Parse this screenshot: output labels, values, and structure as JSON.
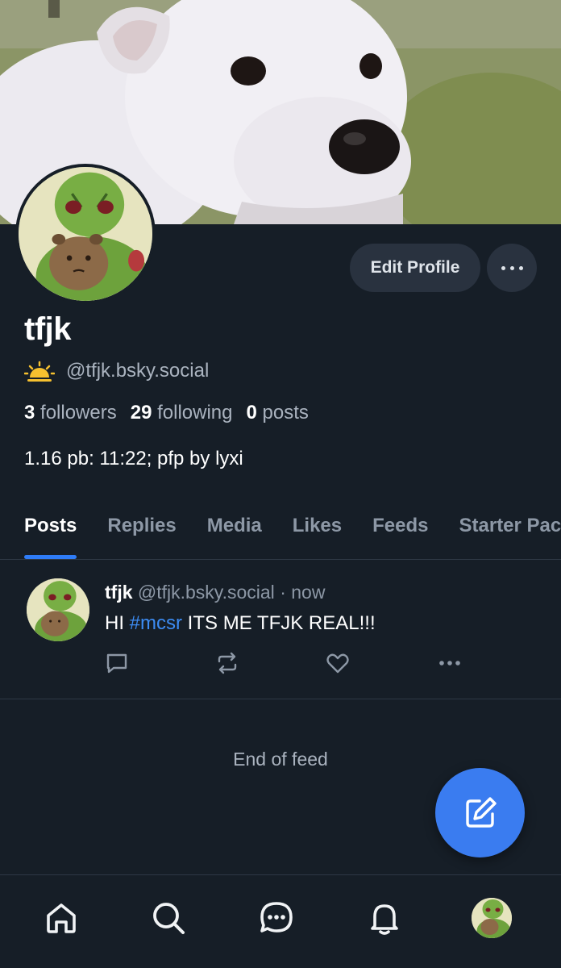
{
  "profile": {
    "display_name": "tfjk",
    "handle": "@tfjk.bsky.social",
    "bio": "1.16 pb: 11:22; pfp by lyxi",
    "status_icon": "sunrise-icon",
    "stats": {
      "followers_count": "3",
      "followers_label": "followers",
      "following_count": "29",
      "following_label": "following",
      "posts_count": "0",
      "posts_label": "posts"
    }
  },
  "header": {
    "edit_profile_label": "Edit Profile",
    "more_icon": "ellipsis-icon"
  },
  "tabs": [
    {
      "label": "Posts",
      "active": true
    },
    {
      "label": "Replies",
      "active": false
    },
    {
      "label": "Media",
      "active": false
    },
    {
      "label": "Likes",
      "active": false
    },
    {
      "label": "Feeds",
      "active": false
    },
    {
      "label": "Starter Packs",
      "active": false
    }
  ],
  "feed": {
    "posts": [
      {
        "author": "tfjk",
        "handle": "@tfjk.bsky.social",
        "separator": "·",
        "time": "now",
        "text_before": "HI ",
        "hashtag": "#mcsr",
        "text_after": " ITS ME TFJK REAL!!!",
        "actions": [
          "reply-icon",
          "repost-icon",
          "like-icon",
          "more-icon"
        ]
      }
    ],
    "end_label": "End of feed"
  },
  "fab": {
    "icon": "compose-icon"
  },
  "bottom_nav": [
    "home-icon",
    "search-icon",
    "chat-icon",
    "notifications-icon",
    "profile-avatar"
  ],
  "colors": {
    "background": "#161e27",
    "accent": "#2f7cf6",
    "hashtag": "#3c8cf4",
    "button_bg": "#29323f",
    "muted_text": "#aab3bf"
  }
}
